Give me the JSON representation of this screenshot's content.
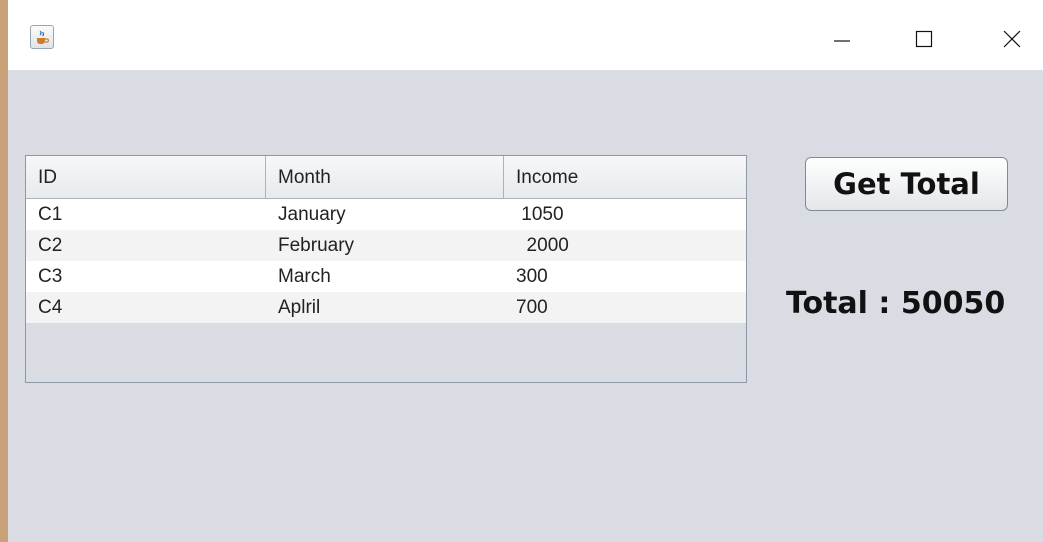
{
  "window": {
    "icon": "java-cup-icon",
    "controls": {
      "minimize": "minimize-icon",
      "maximize": "maximize-icon",
      "close": "close-icon"
    }
  },
  "table": {
    "columns": [
      "ID",
      "Month",
      "Income"
    ],
    "rows": [
      [
        "C1",
        "January",
        " 1050"
      ],
      [
        "C2",
        "February",
        "  2000"
      ],
      [
        "C3",
        "March",
        "300"
      ],
      [
        "C4",
        "Aplril",
        "700"
      ]
    ]
  },
  "actions": {
    "get_total_label": "Get Total"
  },
  "result": {
    "total_text": "Total : 50050"
  }
}
